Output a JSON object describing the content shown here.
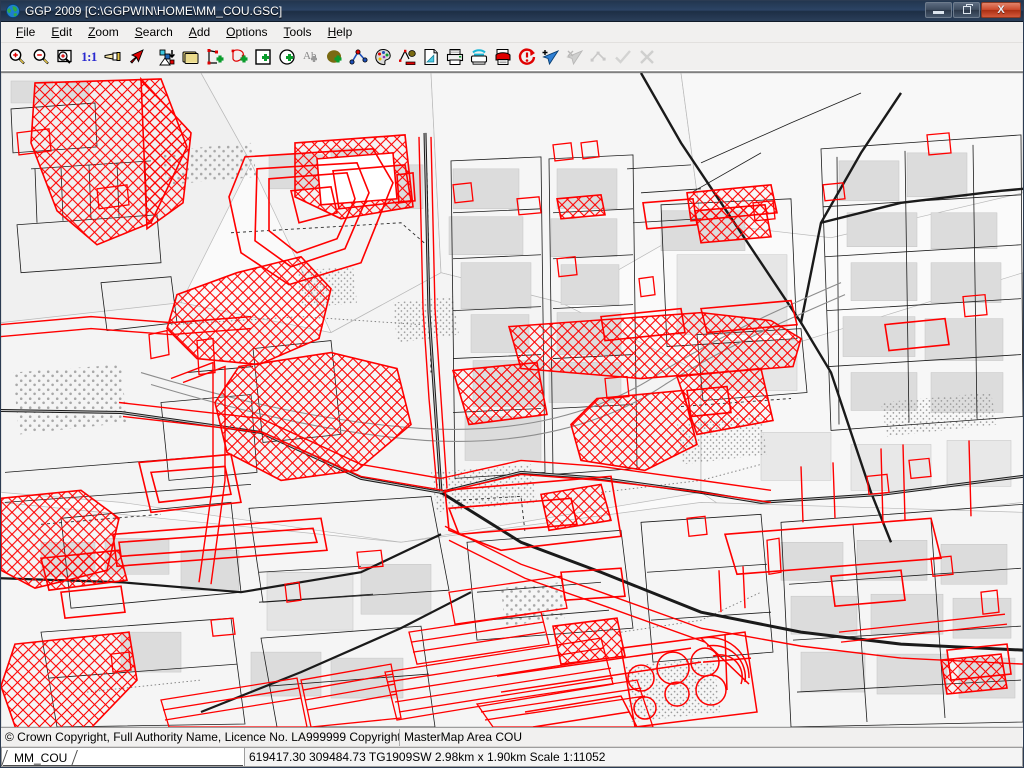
{
  "window": {
    "title": "GGP 2009 [C:\\GGPWIN\\HOME\\MM_COU.GSC]",
    "app_icon": "globe-icon",
    "minimize_label": "",
    "restore_label": "",
    "close_label": "X"
  },
  "menubar": {
    "items": [
      {
        "label": "File",
        "accel": "F"
      },
      {
        "label": "Edit",
        "accel": "E"
      },
      {
        "label": "Zoom",
        "accel": "Z"
      },
      {
        "label": "Search",
        "accel": "S"
      },
      {
        "label": "Add",
        "accel": "A"
      },
      {
        "label": "Options",
        "accel": "O"
      },
      {
        "label": "Tools",
        "accel": "T"
      },
      {
        "label": "Help",
        "accel": "H"
      }
    ]
  },
  "toolbar": {
    "buttons": [
      {
        "icon": "zoom-in-icon",
        "title": "Zoom In",
        "disabled": false
      },
      {
        "icon": "zoom-out-icon",
        "title": "Zoom Out",
        "disabled": false
      },
      {
        "icon": "zoom-window-icon",
        "title": "Zoom Window",
        "disabled": false
      },
      {
        "icon": "scale-1-to-1-icon",
        "title": "1:1",
        "disabled": false,
        "text": "1:1"
      },
      {
        "icon": "pan-hand-icon",
        "title": "Pan",
        "disabled": false
      },
      {
        "icon": "pointer-arrow-icon",
        "title": "Select",
        "disabled": false
      },
      {
        "icon": "layers-download-icon",
        "title": "Import Data",
        "disabled": false
      },
      {
        "icon": "folder-stack-icon",
        "title": "Open Layers",
        "disabled": false
      },
      {
        "icon": "add-polyline-icon",
        "title": "Add Line",
        "disabled": false
      },
      {
        "icon": "add-polygon-icon",
        "title": "Add Polygon",
        "disabled": false
      },
      {
        "icon": "add-rectangle-icon",
        "title": "Add Rectangle",
        "disabled": false
      },
      {
        "icon": "add-circle-icon",
        "title": "Add Circle",
        "disabled": false
      },
      {
        "icon": "add-text-icon",
        "title": "Add Text",
        "disabled": false
      },
      {
        "icon": "add-fill-icon",
        "title": "Add Fill",
        "disabled": false
      },
      {
        "icon": "measure-icon",
        "title": "Measure",
        "disabled": false
      },
      {
        "icon": "palette-icon",
        "title": "Colours",
        "disabled": false
      },
      {
        "icon": "style-editor-icon",
        "title": "Style Editor",
        "disabled": false
      },
      {
        "icon": "page-setup-icon",
        "title": "Page Setup",
        "disabled": false
      },
      {
        "icon": "print-icon",
        "title": "Print",
        "disabled": false
      },
      {
        "icon": "plotter-icon",
        "title": "Plot",
        "disabled": false
      },
      {
        "icon": "print-preview-icon",
        "title": "Print Preview",
        "disabled": false
      },
      {
        "icon": "refresh-warning-icon",
        "title": "Redraw",
        "disabled": false
      },
      {
        "icon": "add-node-icon",
        "title": "Add Node",
        "disabled": false
      },
      {
        "icon": "delete-node-icon",
        "title": "Delete Node",
        "disabled": true
      },
      {
        "icon": "move-node-icon",
        "title": "Move Node",
        "disabled": true
      },
      {
        "icon": "accept-tick-icon",
        "title": "Accept",
        "disabled": true
      },
      {
        "icon": "cancel-cross-icon",
        "title": "Cancel",
        "disabled": true
      }
    ]
  },
  "copyright_bar": {
    "copyright": "© Crown Copyright, Full Authority Name, Licence No. LA999999 Copyright (Year)",
    "layer": "MasterMap Area COU"
  },
  "statusbar": {
    "sheet_tab": "MM_COU",
    "coordinates": "619417.30 309484.73 TG1909SW 2.98km x 1.90km Scale 1:11052",
    "easting": "619417.30",
    "northing": "309484.73",
    "grid_ref": "TG1909SW",
    "extent": "2.98km x 1.90km",
    "scale": "Scale 1:11052"
  },
  "map": {
    "basemap_bg": "#ffffff",
    "overlay_colour": "#ff0000",
    "road_colour": "#1a1a1a",
    "building_fill": "#d8d8d8",
    "parcel_fill": "#efefef",
    "description": "OS MasterMap topography with red hatched COU area polygons"
  }
}
